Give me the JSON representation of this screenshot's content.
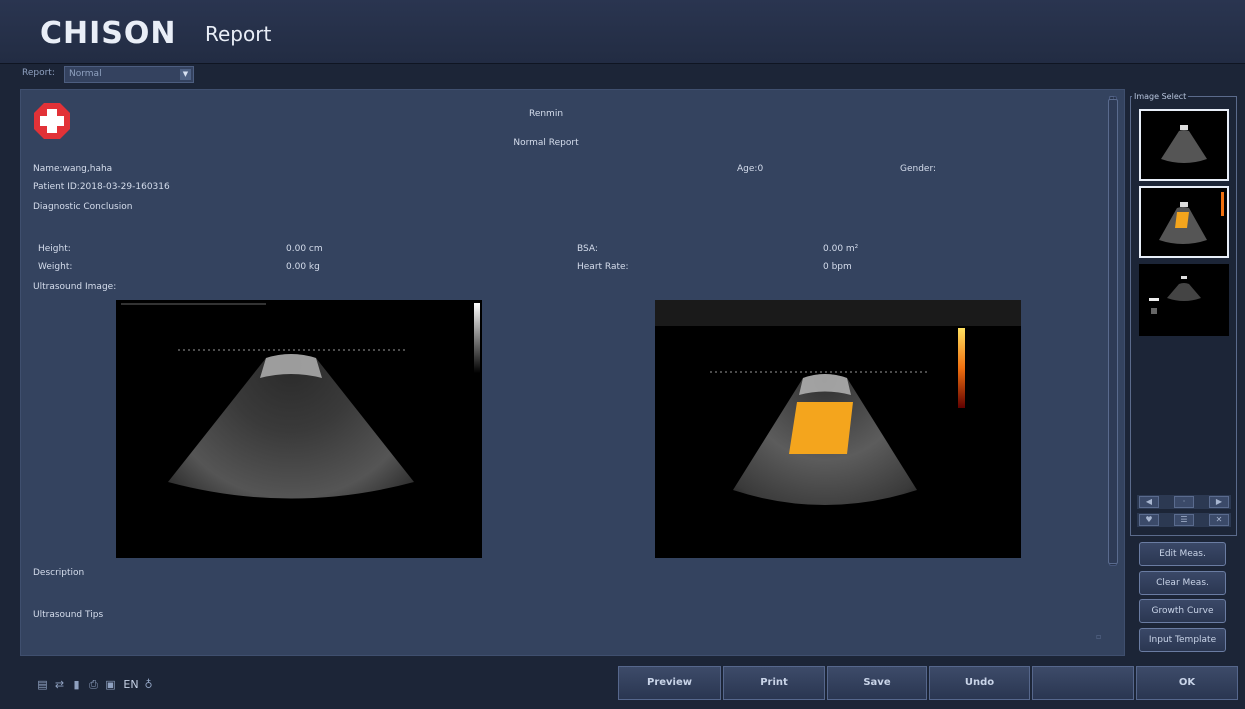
{
  "header": {
    "brand": "CHISON",
    "title": "Report"
  },
  "report_selector": {
    "label": "Report:",
    "value": "Normal"
  },
  "report": {
    "hospital": "Renmin",
    "report_title": "Normal Report",
    "name_line": "Name:wang,haha",
    "patient_id_line": "Patient ID:2018-03-29-160316",
    "age_line": "Age:0",
    "gender_line": "Gender:",
    "diagnostic_conclusion": "Diagnostic Conclusion",
    "measurements": {
      "height_label": "Height:",
      "height_value": "0.00 cm",
      "weight_label": "Weight:",
      "weight_value": "0.00 kg",
      "bsa_label": "BSA:",
      "bsa_value": "0.00 m²",
      "heart_rate_label": "Heart Rate:",
      "heart_rate_value": "0 bpm"
    },
    "ultrasound_image_label": "Ultrasound Image:",
    "description_label": "Description",
    "tips_label": "Ultrasound Tips"
  },
  "image_select": {
    "label": "Image Select"
  },
  "side_buttons": {
    "edit_meas": "Edit Meas.",
    "clear_meas": "Clear Meas.",
    "growth_curve": "Growth Curve",
    "input_template": "Input Template"
  },
  "status_bar": {
    "language": "EN"
  },
  "bottom_buttons": {
    "preview": "Preview",
    "print": "Print",
    "save": "Save",
    "undo": "Undo",
    "ok": "OK"
  },
  "colors": {
    "accent": "#2b3752",
    "panel": "#34435f",
    "logo_red": "#e23237",
    "color_flow": "#f4a51d"
  },
  "icons": [
    "usb-icon",
    "network-icon",
    "storage-icon",
    "printer-icon",
    "disk-icon",
    "microphone-icon"
  ]
}
